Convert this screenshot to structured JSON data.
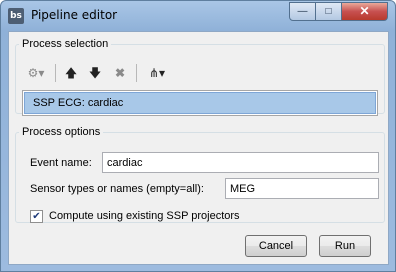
{
  "window": {
    "title": "Pipeline editor",
    "app_icon": "bs",
    "minimize": "—",
    "maximize": "□",
    "close": "✕"
  },
  "process_selection": {
    "legend": "Process selection",
    "toolbar": {
      "gear": "⚙▾",
      "up": "🡅",
      "down": "🡇",
      "delete": "✖",
      "tree": "⋔▾"
    },
    "items": [
      {
        "label": "SSP ECG: cardiac",
        "selected": true
      }
    ]
  },
  "process_options": {
    "legend": "Process options",
    "event_name": {
      "label": "Event name:",
      "value": "cardiac"
    },
    "sensor_types": {
      "label": "Sensor types or names (empty=all):",
      "value": "MEG"
    },
    "checkbox": {
      "label": "Compute using existing SSP projectors",
      "checked": true,
      "mark": "✔"
    }
  },
  "buttons": {
    "cancel": "Cancel",
    "run": "Run"
  }
}
